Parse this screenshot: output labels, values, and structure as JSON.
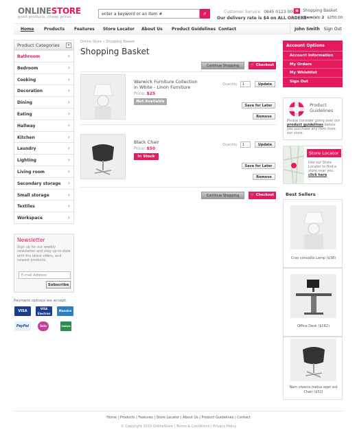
{
  "header": {
    "logo_a": "ONLINE",
    "logo_b": "STORE",
    "tagline": "good products, cheap prices",
    "search_value": "enter a keyword or an item #",
    "search_btn": "🔍",
    "cs_label": "Customer Service",
    "cs_phone": "0845 0123 000",
    "delivery": "Our delivery rate is $4 on ALL ORDERS",
    "cart_label": "Shopping Basket",
    "items_label": "Item(s): 2",
    "items_total": "$250.00"
  },
  "nav": {
    "items": [
      "Home",
      "Products",
      "Features",
      "Store Locator",
      "About Us",
      "Product Guidelines",
      "Contact"
    ],
    "user_name": "John Smith",
    "signout": "Sign Out"
  },
  "categories": {
    "heading": "Product Categories",
    "items": [
      "Bathroom",
      "Bedroom",
      "Cooking",
      "Decoration",
      "Dining",
      "Eating",
      "Hallway",
      "Kitchen",
      "Laundry",
      "Lighting",
      "Living room",
      "Secondary storage",
      "Small storage",
      "Textiles",
      "Workspace"
    ]
  },
  "newsletter": {
    "title": "Newsletter",
    "text": "Sign up for our weekly newsletter and stay up-to-date with the latest offers, and newest products.",
    "placeholder": "E-mail Address",
    "button": "Subscribe"
  },
  "payment": {
    "text": "Payment options we accept.",
    "cards": [
      "VISA",
      "VISA Electron",
      "Maestro",
      "PayPal",
      "Solo",
      "Switch"
    ]
  },
  "main": {
    "breadcrumb": "Online Store » Shopping Basket",
    "title": "Shopping Basket",
    "continue": "Continue Shopping",
    "checkout": "Checkout",
    "products": [
      {
        "name": "Warwick Furniture Collection in White - Linon Furniture",
        "price_label": "Price:",
        "price": "$25",
        "status": "Not Available",
        "qty_label": "Quantity",
        "qty": "1",
        "update": "Update",
        "save": "Save for Later",
        "remove": "Remove"
      },
      {
        "name": "Black Chair",
        "price_label": "Price:",
        "price": "$50",
        "status": "In Stock",
        "qty_label": "Quantity",
        "qty": "1",
        "update": "Update",
        "save": "Save for Later",
        "remove": "Remove"
      }
    ]
  },
  "account": {
    "heading": "Account Options",
    "items": [
      "Account Information",
      "My Orders",
      "My Whishlist",
      "Sign Out"
    ]
  },
  "guidelines": {
    "title": "Product Guidelines",
    "text_before": "Please consider going over our",
    "link": "product guidelines",
    "text_after": "before you purchase any item from our store."
  },
  "locator": {
    "title": "Store Locator",
    "text": "Use our Store Locator to find a store near you.",
    "link": "click here"
  },
  "bestsellers": {
    "heading": "Best Sellers",
    "items": [
      "Cras convallis Lamp ($38)",
      "Office Desk ($182)",
      "Nam viverra metus eget est Chair ($52)"
    ]
  },
  "footer": {
    "links": "Home | Products | Features | Store Locator | About Us | Product Guidelines | Contact",
    "copyright": "© Copyright 2010 OnlineStore | Terms & Conditions | Privacy Policy"
  },
  "colors": {
    "accent": "#e5195e",
    "grey_btn": "#aaaaaa",
    "not_available": "#aaaaaa"
  }
}
